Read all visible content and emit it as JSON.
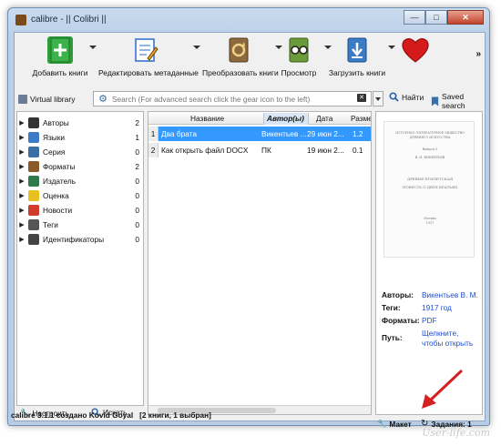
{
  "window": {
    "title": "calibre - || Colibri ||"
  },
  "toolbar": {
    "items": [
      {
        "label": "Добавить книги",
        "icon": "add-book-icon",
        "color": "#2e9c3a"
      },
      {
        "label": "Редактировать метаданные",
        "icon": "edit-metadata-icon",
        "color": "#2a6bc7"
      },
      {
        "label": "Преобразовать книги",
        "icon": "convert-book-icon",
        "color": "#8b6a3e"
      },
      {
        "label": "Просмотр",
        "icon": "view-book-icon",
        "color": "#5a8a2a"
      },
      {
        "label": "Загрузить книги",
        "icon": "download-icon",
        "color": "#3a7cc8"
      },
      {
        "label": "",
        "icon": "heart-icon",
        "color": "#d41a1a"
      }
    ],
    "more": "»"
  },
  "searchbar": {
    "virtual_library": "Virtual library",
    "placeholder": "Search (For advanced search click the gear icon to the left)",
    "find": "Найти",
    "saved_search": "Saved search"
  },
  "tag_browser": {
    "items": [
      {
        "label": "Авторы",
        "count": "2",
        "icon": "authors-icon",
        "color": "#333333"
      },
      {
        "label": "Языки",
        "count": "1",
        "icon": "languages-icon",
        "color": "#3a7cc8"
      },
      {
        "label": "Серия",
        "count": "0",
        "icon": "series-icon",
        "color": "#3a6ea5"
      },
      {
        "label": "Форматы",
        "count": "2",
        "icon": "formats-icon",
        "color": "#8b5a2b"
      },
      {
        "label": "Издатель",
        "count": "0",
        "icon": "publisher-icon",
        "color": "#2f7a4a"
      },
      {
        "label": "Оценка",
        "count": "0",
        "icon": "rating-star-icon",
        "color": "#e8c020"
      },
      {
        "label": "Новости",
        "count": "0",
        "icon": "news-icon",
        "color": "#d23c2c"
      },
      {
        "label": "Теги",
        "count": "0",
        "icon": "tags-icon",
        "color": "#555555"
      },
      {
        "label": "Идентификаторы",
        "count": "0",
        "icon": "identifiers-icon",
        "color": "#444444"
      }
    ],
    "configure": "Настроить",
    "find": "Искать"
  },
  "book_list": {
    "columns": [
      "Название",
      "Автор(ы)",
      "Дата",
      "Размер ("
    ],
    "rows": [
      {
        "num": "1",
        "title": "Два брата",
        "author": "Викентьев ...",
        "date": "29 июн 2...",
        "size": "1.2",
        "selected": true
      },
      {
        "num": "2",
        "title": "Как открыть файл DOCX",
        "author": "ПК",
        "date": "19 июн 2...",
        "size": "0.1",
        "selected": false
      }
    ]
  },
  "details": {
    "cover_lines": [
      "ИСТОРИКО-ЛИТЕРАТУРНОЕ ОБЩЕСТВО",
      "ДРЕВНЕГО ИСКУССТВА",
      "Выпуск 5",
      "В. И. ВИКЕНТЬЕВ",
      "ДРЕВНЕ-ЕГИПЕТСКАЯ",
      "ПОВЕСТЬ О ДВУХ БРАТЬЯХ",
      "Москва",
      "1917"
    ],
    "fields": [
      {
        "key": "Авторы:",
        "value": "Викентьев В. М."
      },
      {
        "key": "Теги:",
        "value": "1917 год"
      },
      {
        "key": "Форматы:",
        "value": "PDF"
      },
      {
        "key": "Путь:",
        "value": "Щелкните, чтобы открыть"
      }
    ]
  },
  "status": {
    "left_main": "calibre 3.1.1 создано Kovid Goyal",
    "left_count": "[2 книги, 1 выбран]",
    "layout": "Макет",
    "jobs": "Задания: 1"
  },
  "watermark": "User-life.com",
  "colors": {
    "selection": "#3399ff",
    "link": "#1d4fcf",
    "annotation_arrow": "#d42020"
  }
}
